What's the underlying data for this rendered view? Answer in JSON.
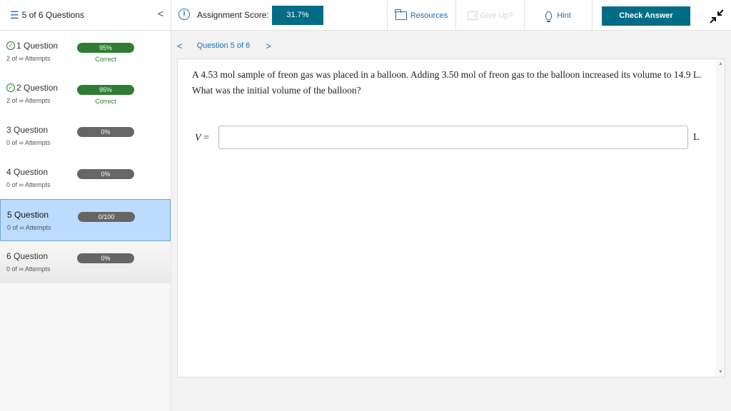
{
  "sidebar": {
    "header_title": "5 of 6 Questions",
    "collapse_glyph": "<",
    "questions": [
      {
        "label": "1 Question",
        "attempts": "2 of ∞ Attempts",
        "score": "95%",
        "status": "Correct"
      },
      {
        "label": "2 Question",
        "attempts": "2 of ∞ Attempts",
        "score": "95%",
        "status": "Correct"
      },
      {
        "label": "3 Question",
        "attempts": "0 of ∞ Attempts",
        "score": "0%",
        "status": ""
      },
      {
        "label": "4 Question",
        "attempts": "0 of ∞ Attempts",
        "score": "0%",
        "status": ""
      },
      {
        "label": "5 Question",
        "attempts": "0 of ∞ Attempts",
        "score": "0/100",
        "status": ""
      },
      {
        "label": "6 Question",
        "attempts": "0 of ∞ Attempts",
        "score": "0%",
        "status": ""
      }
    ]
  },
  "topbar": {
    "info_glyph": "i",
    "score_label": "Assignment Score:",
    "score_value": "31.7%",
    "resources_label": "Resources",
    "giveup_label": "Give Up?",
    "hint_label": "Hint",
    "check_label": "Check Answer"
  },
  "qnav": {
    "prev_glyph": "<",
    "label": "Question 5 of 6",
    "next_glyph": ">"
  },
  "question": {
    "text": "A 4.53 mol sample of freon gas was placed in a balloon. Adding 3.50 mol of freon gas to the balloon increased its volume to 14.9 L. What was the initial volume of the balloon?",
    "variable": "V",
    "equals": "=",
    "answer_value": "",
    "unit": "L"
  },
  "colors": {
    "accent_blue": "#1a6fb5",
    "teal": "#006c85",
    "correct_green": "#2e7d32",
    "active_row": "#bcdcff"
  }
}
